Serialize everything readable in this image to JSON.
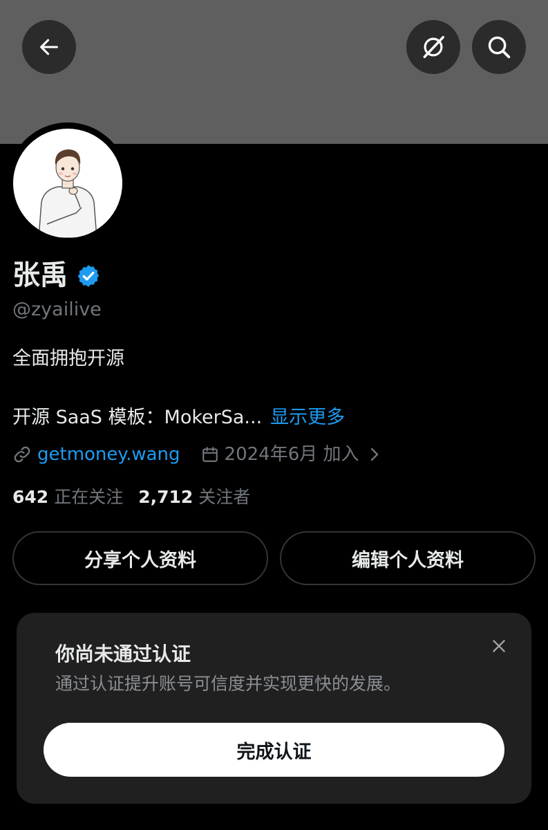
{
  "header": {
    "back_icon": "arrow-left-icon",
    "grok_icon": "grok-icon",
    "search_icon": "search-icon"
  },
  "profile": {
    "display_name": "张禹",
    "verified_icon": "verified-badge-icon",
    "handle": "@zyailive",
    "bio_line1": "全面拥抱开源",
    "bio_line2": "开源 SaaS 模板：MokerSa...",
    "show_more": "显示更多",
    "website": "getmoney.wang",
    "joined": "2024年6月 加入",
    "following_count": "642",
    "following_label": "正在关注",
    "followers_count": "2,712",
    "followers_label": "关注者"
  },
  "actions": {
    "share_label": "分享个人资料",
    "edit_label": "编辑个人资料"
  },
  "verification_card": {
    "title": "你尚未通过认证",
    "subtitle": "通过认证提升账号可信度并实现更快的发展。",
    "button_label": "完成认证"
  },
  "colors": {
    "background": "#000000",
    "banner": "#5f5f5f",
    "accent": "#1d9bf0",
    "muted_text": "#71767b",
    "card_bg": "#202020"
  }
}
